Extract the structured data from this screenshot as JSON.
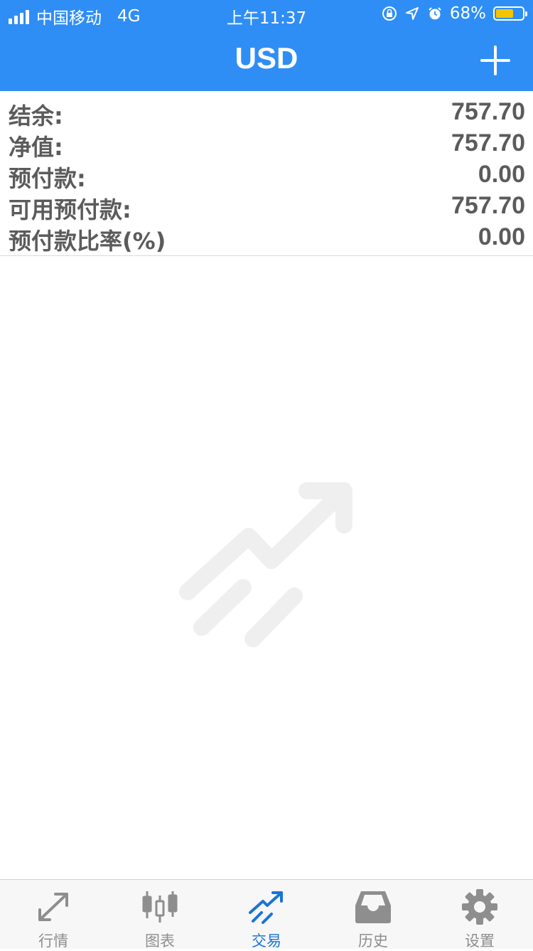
{
  "status_bar": {
    "carrier": "中国移动",
    "network": "4G",
    "time": "上午11:37",
    "battery_percent": "68%",
    "battery_level": 0.68
  },
  "header": {
    "title": "USD",
    "add_icon": "plus-icon"
  },
  "summary": {
    "rows": [
      {
        "label": "结余:",
        "value": "757.70"
      },
      {
        "label": "净值:",
        "value": "757.70"
      },
      {
        "label": "预付款:",
        "value": "0.00"
      },
      {
        "label": "可用预付款:",
        "value": "757.70"
      },
      {
        "label": "预付款比率(%)",
        "value": "0.00"
      }
    ]
  },
  "empty_state": {
    "icon": "trade-arrow-watermark-icon",
    "color": "#efefef"
  },
  "tab_bar": {
    "active_color": "#1a74d8",
    "inactive_color": "#8e8e8e",
    "tabs": [
      {
        "label": "行情",
        "icon": "quotes-arrows-icon"
      },
      {
        "label": "图表",
        "icon": "candlestick-chart-icon"
      },
      {
        "label": "交易",
        "icon": "trade-arrow-icon"
      },
      {
        "label": "历史",
        "icon": "inbox-tray-icon"
      },
      {
        "label": "设置",
        "icon": "gear-icon"
      }
    ]
  },
  "colors": {
    "header_background": "#2f8ef5",
    "text_gray": "#5b5b5b"
  }
}
